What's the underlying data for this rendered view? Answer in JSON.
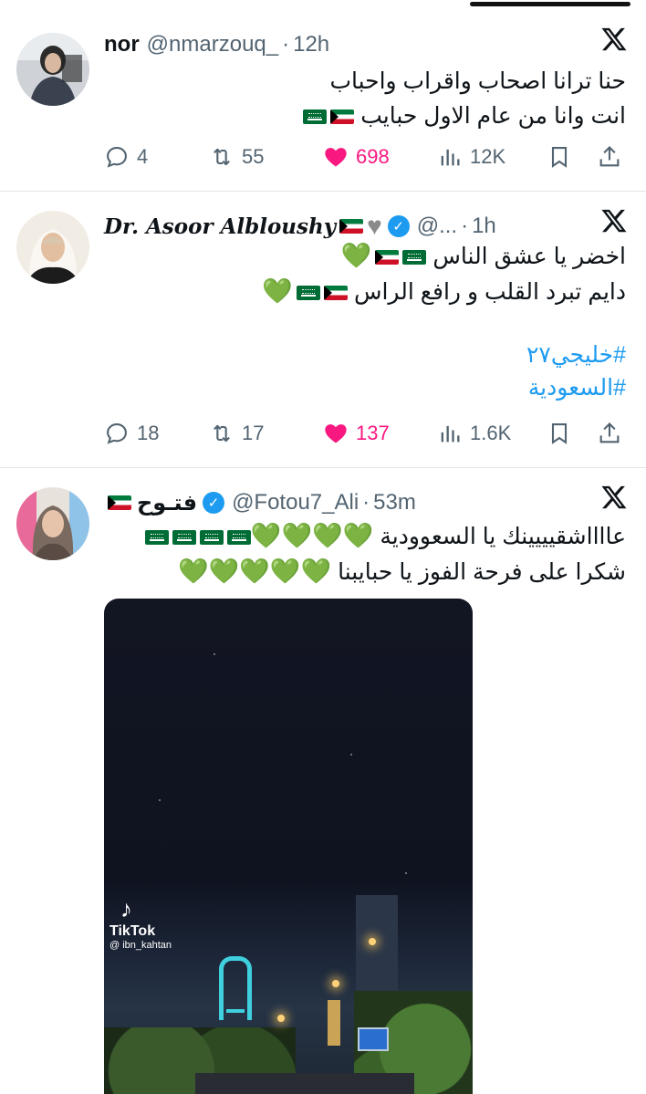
{
  "tweets": [
    {
      "name": "nor",
      "handle": "@nmarzouq_",
      "time": "12h",
      "lines": [
        "حنا ترانا اصحاب واقراب واحباب",
        "انت وانا من عام الاول حبايب"
      ],
      "replies": "4",
      "retweets": "55",
      "likes": "698",
      "views": "12K"
    },
    {
      "name": "Dr. Asoor Albloushy",
      "handle": "@...",
      "time": "1h",
      "lines": [
        "اخضر يا عشق الناس",
        "دايم تبرد القلب و رافع الراس"
      ],
      "hashtags": [
        "#خليجي٢٧",
        "#السعودية"
      ],
      "replies": "18",
      "retweets": "17",
      "likes": "137",
      "views": "1.6K"
    },
    {
      "name": "فتـوح",
      "handle": "@Fotou7_Ali",
      "time": "53m",
      "lines": [
        "عااااشقيييينك يا السعوودية",
        "شكرا على فرحة الفوز  يا حبايبنا"
      ],
      "media": {
        "watermark": "TikTok",
        "watermark_user": "@ ibn_kahtan"
      }
    }
  ],
  "separator": "·",
  "colors": {
    "like": "#f91880",
    "hashtag": "#1d9bf0",
    "verified": "#1d9bf0",
    "secondary": "#536471"
  }
}
